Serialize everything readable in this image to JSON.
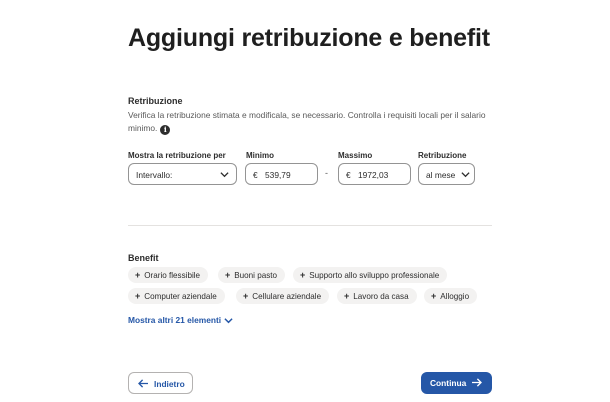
{
  "page_title": "Aggiungi retribuzione e benefit",
  "pay": {
    "section_title": "Retribuzione",
    "description": "Verifica la retribuzione stimata e modificala, se necessario. Controlla i requisiti locali per il salario minimo.",
    "show_pay_label": "Mostra la retribuzione per",
    "show_pay_value": "Intervallo:",
    "min_label": "Minimo",
    "currency": "€",
    "min_value": "539,79",
    "range_separator": "-",
    "max_label": "Massimo",
    "max_value": "1972,03",
    "rate_label": "Retribuzione",
    "rate_value": "al mese"
  },
  "benefits": {
    "section_title": "Benefit",
    "chips": [
      "Orario flessibile",
      "Buoni pasto",
      "Supporto allo sviluppo professionale",
      "Computer aziendale",
      "Cellulare aziendale",
      "Lavoro da casa",
      "Alloggio"
    ],
    "show_more": "Mostra altri 21 elementi"
  },
  "nav": {
    "back_label": "Indietro",
    "continue_label": "Continua"
  },
  "colors": {
    "primary": "#2557a7",
    "chip_bg": "#f3f2f1",
    "border": "#949494"
  },
  "icons": {
    "info": "info-icon",
    "select": "chevron-down-icon",
    "chip": "plus-icon",
    "back": "arrow-left-icon",
    "continue": "arrow-right-icon"
  }
}
